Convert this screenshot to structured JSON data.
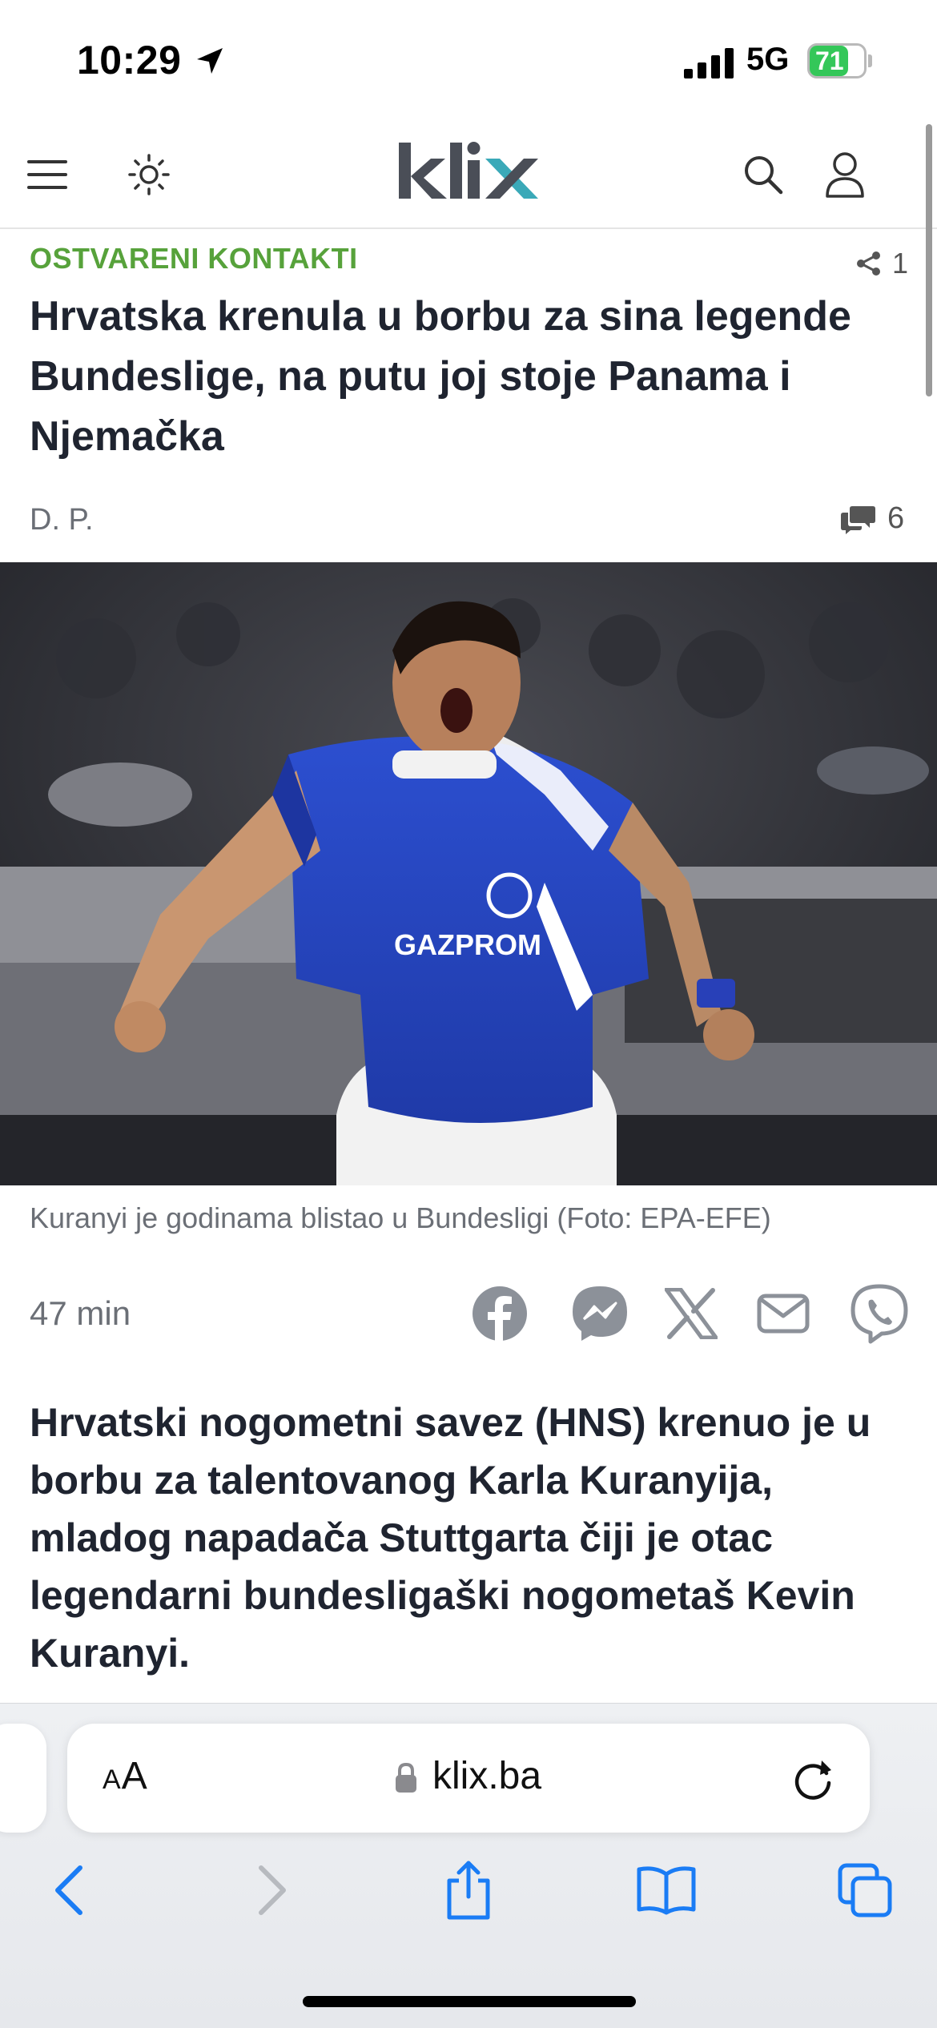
{
  "status_bar": {
    "time": "10:29",
    "network": "5G",
    "battery": "71",
    "battery_level": 0.71
  },
  "header": {
    "logo_alt": "klix"
  },
  "article": {
    "category": "OSTVARENI KONTAKTI",
    "share_count": "1",
    "headline": "Hrvatska krenula u borbu za sina legende Bundeslige, na putu joj stoje Panama i Njemačka",
    "author": "D. P.",
    "comment_count": "6",
    "photo_caption": "Kuranyi je godinama blistao u Bundesligi (Foto: EPA-EFE)",
    "photo_shirt_text": "GAZPROM",
    "time_ago": "47 min",
    "lead": "Hrvatski nogometni savez (HNS) krenuo je u borbu za talentovanog Karla Kuranyija, mladog napadača Stuttgarta čiji je otac legendarni bundesligaški nogometaš Kevin Kuranyi."
  },
  "share_icons": [
    "facebook-icon",
    "messenger-icon",
    "x-icon",
    "mail-icon",
    "viber-icon"
  ],
  "safari": {
    "text_size_small": "A",
    "text_size_large": "A",
    "url": "klix.ba"
  },
  "colors": {
    "accent_green": "#57a23b",
    "ios_blue": "#1a7cf5",
    "logo_gray": "#4a4e57",
    "logo_teal": "#3aa9b8"
  }
}
